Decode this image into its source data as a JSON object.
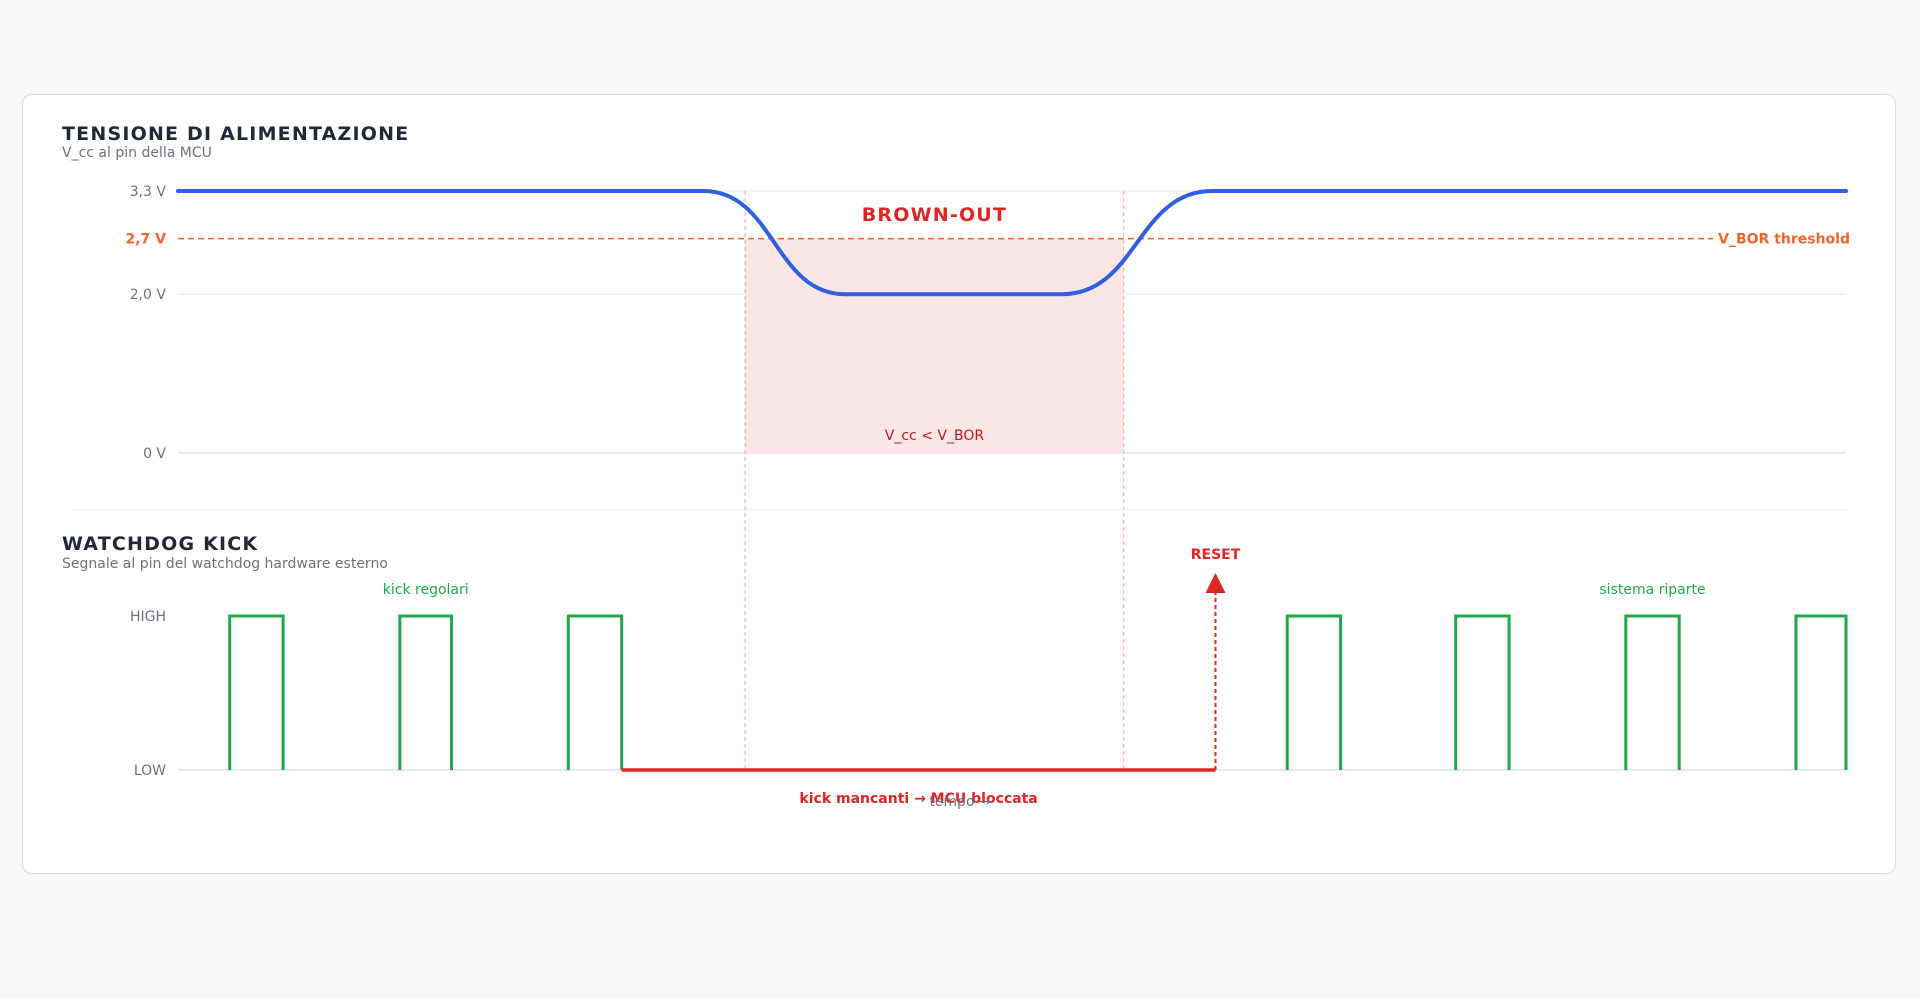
{
  "colors": {
    "voltage": "#3060e0",
    "threshold": "#f0642d",
    "kick": "#22a84a",
    "fault": "#dc2626",
    "zone": "#fbe6e6",
    "grid": "#e5e7eb",
    "axis": "#d1d5db"
  },
  "chart_data": [
    {
      "type": "line",
      "title": "TENSIONE DI ALIMENTAZIONE",
      "subtitle": "V_cc al pin della MCU",
      "y_ticks": [
        "3,3 V",
        "2,0 V",
        "0 V"
      ],
      "ylim": [
        0,
        3.3
      ],
      "xlim": [
        0,
        100
      ],
      "threshold": {
        "value": 2.7,
        "tick_label": "2,7 V",
        "label": "V_BOR threshold"
      },
      "series": [
        {
          "points": [
            [
              0,
              3.3
            ],
            [
              31.5,
              3.3
            ],
            [
              35.5,
              2.7
            ],
            [
              40,
              2.0
            ],
            [
              53,
              2.0
            ],
            [
              57.5,
              2.7
            ],
            [
              62,
              3.3
            ],
            [
              100,
              3.3
            ]
          ]
        }
      ],
      "zone": {
        "x_start": 34,
        "x_end": 56.7,
        "label": "BROWN-OUT",
        "sublabel": "V_cc < V_BOR"
      }
    },
    {
      "type": "line",
      "title": "WATCHDOG KICK",
      "subtitle": "Segnale al pin del watchdog hardware esterno",
      "y_ticks": [
        "HIGH",
        "LOW"
      ],
      "xlim": [
        0,
        100
      ],
      "pulses": [
        [
          3.1,
          6.3
        ],
        [
          13.3,
          16.4
        ],
        [
          23.4,
          26.6
        ],
        [
          66.5,
          69.7
        ],
        [
          76.6,
          79.8
        ],
        [
          86.8,
          90
        ],
        [
          97,
          100
        ]
      ],
      "missing_kicks": {
        "x_start": 26.6,
        "x_end": 62.2,
        "label": "kick mancanti → MCU bloccata"
      },
      "reset": {
        "x": 62.2,
        "label": "RESET"
      },
      "annotations": {
        "before": "kick regolari",
        "after": "sistema riparte"
      },
      "xlabel": "tempo →"
    }
  ]
}
